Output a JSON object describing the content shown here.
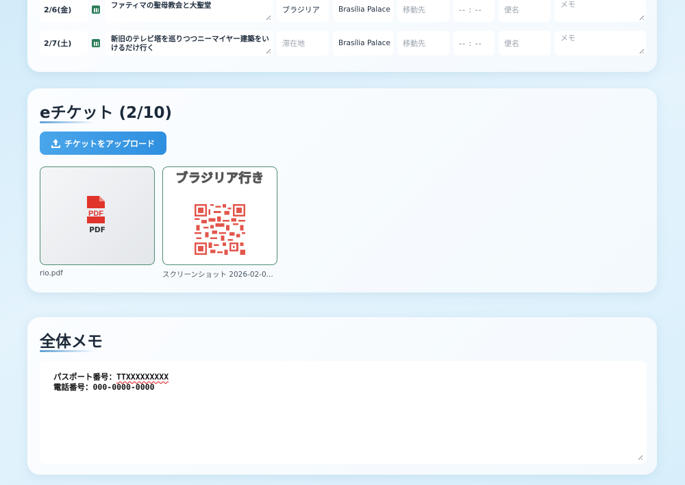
{
  "schedule": {
    "rows": [
      {
        "date": "2/6(金)",
        "title": "ファティマの聖母教会と大聖堂",
        "place": "ブラジリア",
        "hotel": "Brasília Palace",
        "dest_placeholder": "移動先",
        "time": "-- : --",
        "flight_placeholder": "便名",
        "memo_placeholder": "メモ"
      },
      {
        "date": "2/7(土)",
        "title": "新旧のテレビ塔を巡りつつニーマイヤー建築をいけるだけ行く",
        "place_placeholder": "滞在地",
        "hotel": "Brasília Palace",
        "dest_placeholder": "移動先",
        "time": "-- : --",
        "flight_placeholder": "便名",
        "memo_placeholder": "メモ"
      }
    ]
  },
  "tickets": {
    "title": "eチケット (2/10)",
    "upload_label": "チケットをアップロード",
    "items": [
      {
        "type": "pdf",
        "badge": "PDF",
        "name": "rio.pdf"
      },
      {
        "type": "image",
        "image_text": "ブラジリア行き",
        "name": "スクリーンショット 2026-02-0..."
      }
    ]
  },
  "memo": {
    "title": "全体メモ",
    "lines": [
      {
        "label": "パスポート番号：",
        "value": "TTXXXXXXXXX"
      },
      {
        "label": "電話番号：",
        "value": "000-0000-0000"
      }
    ]
  },
  "colors": {
    "accent": "#2f8fe0",
    "thumb_border": "#4f8c72",
    "pdf_red": "#e0332b",
    "calendar_green": "#2e7d5b"
  }
}
